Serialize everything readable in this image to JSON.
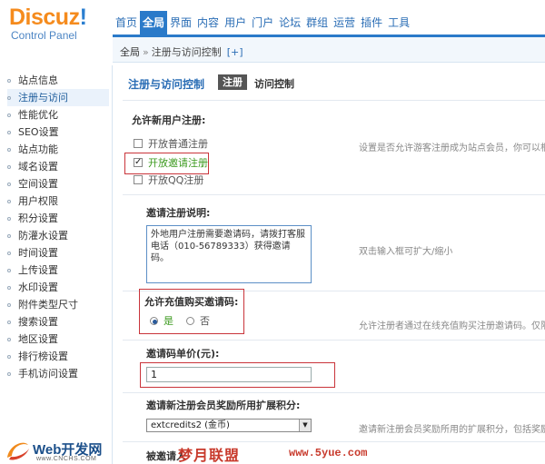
{
  "header": {
    "logo_main_a": "Discuz",
    "logo_main_b": "!",
    "logo_sub": "Control Panel",
    "nav": [
      "首页",
      "全局",
      "界面",
      "内容",
      "用户",
      "门户",
      "论坛",
      "群组",
      "运营",
      "插件",
      "工具"
    ],
    "nav_active_index": 1
  },
  "breadcrumb": {
    "root": "全局",
    "separator": "»",
    "current": "注册与访问控制",
    "add": "[+]"
  },
  "sidebar": {
    "items": [
      "站点信息",
      "注册与访问",
      "性能优化",
      "SEO设置",
      "站点功能",
      "域名设置",
      "空间设置",
      "用户权限",
      "积分设置",
      "防灌水设置",
      "时间设置",
      "上传设置",
      "水印设置",
      "附件类型尺寸",
      "搜索设置",
      "地区设置",
      "排行榜设置",
      "手机访问设置"
    ],
    "active_index": 1,
    "footer_logo_text": "Web开发网",
    "footer_logo_sub": "www.CNCHS.COM"
  },
  "main": {
    "title": "注册与访问控制",
    "tab_register": "注册",
    "tab_access": "访问控制",
    "allow_register_label": "允许新用户注册:",
    "options": [
      {
        "label": "开放普通注册",
        "checked": false
      },
      {
        "label": "开放邀请注册",
        "checked": true
      },
      {
        "label": "开放QQ注册",
        "checked": false
      }
    ],
    "allow_register_hint": "设置是否允许游客注册成为站点会员，你可以根据",
    "invite_desc_label": "邀请注册说明:",
    "invite_desc_value": "外地用户注册需要邀请码，请拨打客服电话（010-56789333）获得邀请码。",
    "invite_desc_hint": "双击输入框可扩大/缩小",
    "buy_invite_label": "允许充值购买邀请码:",
    "buy_invite_yes": "是",
    "buy_invite_no": "否",
    "buy_invite_selected": "yes",
    "buy_invite_hint": "允许注册者通过在线充值购买注册邀请码。仅限于无",
    "invite_price_label": "邀请码单价(元):",
    "invite_price_value": "1",
    "reward_label": "邀请新注册会员奖励所用扩展积分:",
    "reward_select_value": "extcredits2 (金币)",
    "reward_hint": "邀请新注册会员奖励所用的扩展积分，包括奖励邀",
    "bottom_label_partial": "被邀请人"
  },
  "watermark": {
    "text_cn": "梦月联盟",
    "text_url": "www.5yue.com"
  },
  "colors": {
    "accent_blue": "#2a7ac9",
    "logo_orange": "#f58b1d",
    "highlight_red": "#c9343a",
    "green_text": "#3c9a1f"
  }
}
